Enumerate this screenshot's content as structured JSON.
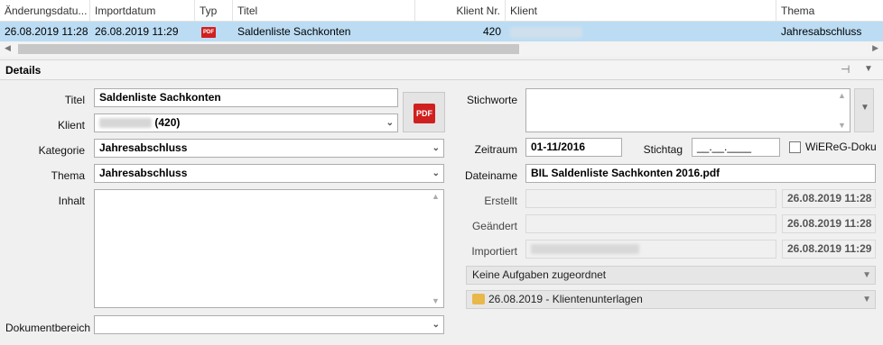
{
  "grid": {
    "columns": [
      "Änderungsdatu...",
      "Importdatum",
      "Typ",
      "Titel",
      "Klient Nr.",
      "Klient",
      "Thema"
    ],
    "row": {
      "changed": "26.08.2019 11:28",
      "imported": "26.08.2019 11:29",
      "type_icon": "PDF",
      "title": "Saldenliste Sachkonten",
      "client_no": "420",
      "topic": "Jahresabschluss"
    }
  },
  "details": {
    "header": "Details",
    "labels": {
      "title": "Titel",
      "client": "Klient",
      "category": "Kategorie",
      "topic": "Thema",
      "content": "Inhalt",
      "doc_area": "Dokumentbereich",
      "keywords": "Stichworte",
      "period": "Zeitraum",
      "deadline": "Stichtag",
      "wiereg": "WiEReG-Doku",
      "filename": "Dateiname",
      "created": "Erstellt",
      "modified": "Geändert",
      "imported": "Importiert"
    },
    "values": {
      "title": "Saldenliste Sachkonten",
      "client": "(420)",
      "category": "Jahresabschluss",
      "topic": "Jahresabschluss",
      "content": "",
      "doc_area": "",
      "keywords": "",
      "period": "01-11/2016",
      "deadline": "__.__.____",
      "filename": "BIL Saldenliste Sachkonten 2016.pdf",
      "created": "26.08.2019 11:28",
      "modified": "26.08.2019 11:28",
      "imported": "26.08.2019 11:29",
      "tasks": "Keine Aufgaben zugeordnet",
      "folder": "26.08.2019 - Klientenunterlagen"
    },
    "pdf_button": "PDF"
  }
}
